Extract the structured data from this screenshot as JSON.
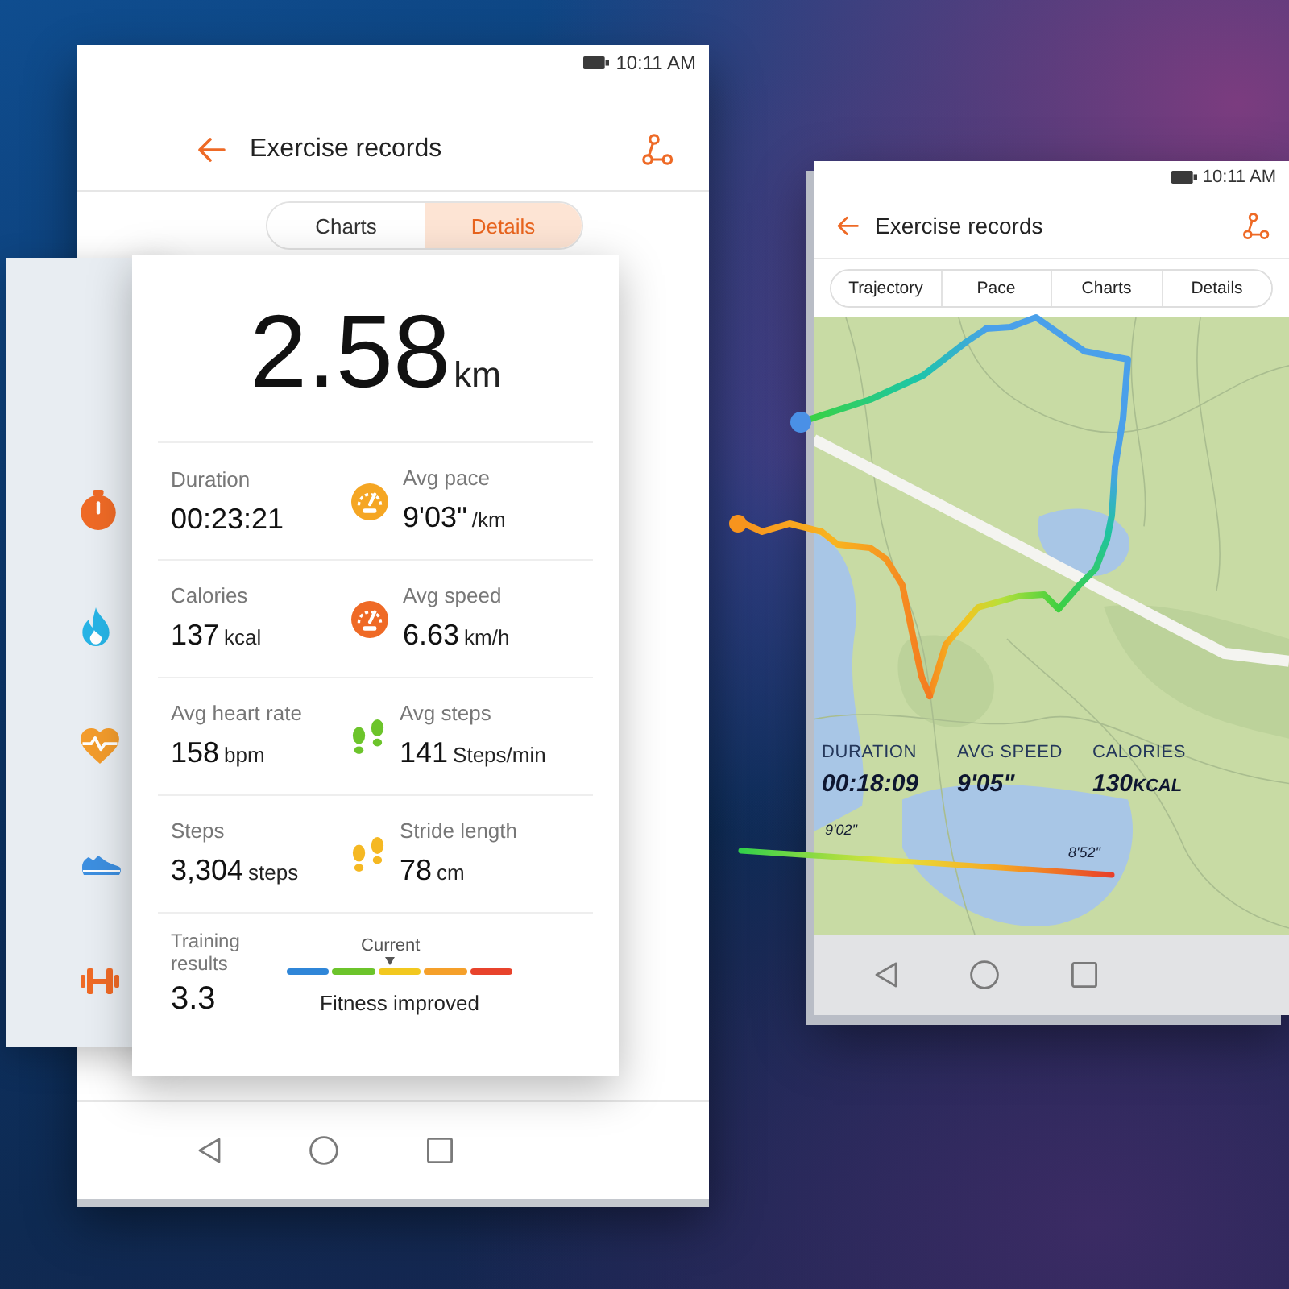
{
  "left_phone": {
    "status_bar": {
      "time": "10:11 AM"
    },
    "title": "Exercise records",
    "tabs": [
      {
        "label": "Charts",
        "selected": false
      },
      {
        "label": "Details",
        "selected": true
      }
    ],
    "distance": {
      "value": "2.58",
      "unit": "km"
    },
    "stats": [
      {
        "label": "Duration",
        "value": "00:23:21"
      },
      {
        "label": "Avg pace",
        "value": "9'03\"",
        "unit": "/km"
      },
      {
        "label": "Calories",
        "value": "137",
        "unit": "kcal"
      },
      {
        "label": "Avg speed",
        "value": "6.63",
        "unit": "km/h"
      },
      {
        "label": "Avg heart rate",
        "value": "158",
        "unit": "bpm"
      },
      {
        "label": "Avg steps",
        "value": "141",
        "unit": "Steps/min"
      },
      {
        "label": "Steps",
        "value": "3,304",
        "unit": "steps"
      },
      {
        "label": "Stride length",
        "value": "78",
        "unit": "cm"
      }
    ],
    "training": {
      "label": "Training results",
      "value": "3.3",
      "scale_label": "Current",
      "level": 0.46,
      "verdict": "Fitness improved"
    }
  },
  "right_phone": {
    "status_bar": {
      "time": "10:11 AM"
    },
    "title": "Exercise records",
    "tabs": [
      {
        "label": "Trajectory",
        "selected": false
      },
      {
        "label": "Pace",
        "selected": false
      },
      {
        "label": "Charts",
        "selected": false
      },
      {
        "label": "Details",
        "selected": false
      }
    ]
  },
  "overlay": {
    "stats": [
      {
        "label": "DURATION",
        "value": "00:18:09"
      },
      {
        "label": "AVG SPEED",
        "value": "9'05\""
      },
      {
        "label": "CALORIES",
        "value": "130",
        "unit": "KCAL"
      }
    ],
    "pace_scale": {
      "start": "9'02\"",
      "end": "8'52\""
    }
  }
}
